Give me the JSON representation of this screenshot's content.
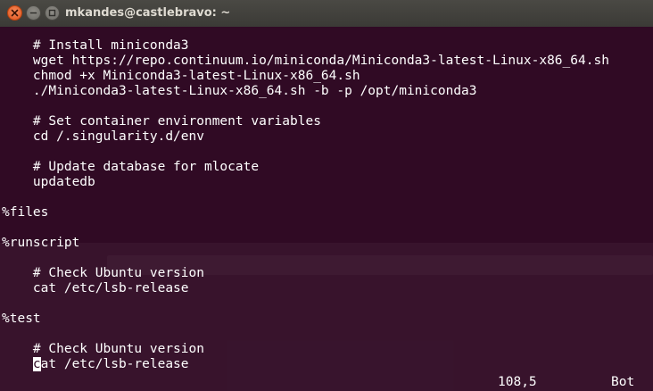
{
  "window": {
    "title": "mkandes@castlebravo: ~"
  },
  "terminal": {
    "lines": [
      "    # Install miniconda3",
      "    wget https://repo.continuum.io/miniconda/Miniconda3-latest-Linux-x86_64.sh",
      "    chmod +x Miniconda3-latest-Linux-x86_64.sh",
      "    ./Miniconda3-latest-Linux-x86_64.sh -b -p /opt/miniconda3",
      "",
      "    # Set container environment variables",
      "    cd /.singularity.d/env",
      "",
      "    # Update database for mlocate",
      "    updatedb",
      "",
      "%files",
      "",
      "%runscript",
      "",
      "    # Check Ubuntu version",
      "    cat /etc/lsb-release",
      "",
      "%test",
      "",
      "    # Check Ubuntu version"
    ],
    "last_line_indent": "    ",
    "cursor_char": "c",
    "last_line_rest": "at /etc/lsb-release",
    "status_position": "108,5",
    "status_scroll": "Bot"
  },
  "colors": {
    "terminal_background": "#300a24",
    "terminal_foreground": "#ffffff",
    "close_button": "#e0541c"
  },
  "icons": {
    "close": "close-icon",
    "minimize": "minimize-icon",
    "maximize": "maximize-icon"
  }
}
